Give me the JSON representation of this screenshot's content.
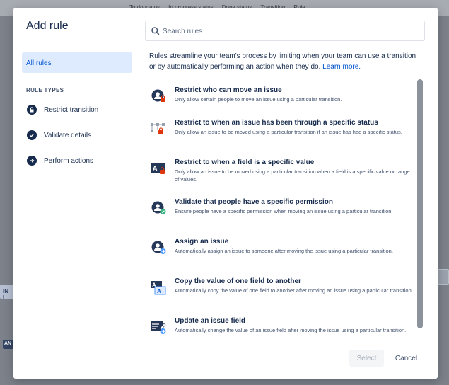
{
  "background": {
    "tabs": [
      "To do status",
      "In progress status",
      "Done status",
      "Transition",
      "Rule"
    ],
    "tag_in": "IN I",
    "tag_an": "AN"
  },
  "modal": {
    "title": "Add rule",
    "search": {
      "placeholder": "Search rules",
      "value": ""
    },
    "intro": "Rules streamline your team's process by limiting when your team can use a transition or by automatically performing an action when they do.",
    "learn_more": "Learn more.",
    "sidebar": {
      "all_rules": "All rules",
      "heading": "RULE TYPES",
      "items": [
        {
          "label": "Restrict transition",
          "icon": "lock-icon"
        },
        {
          "label": "Validate details",
          "icon": "check-circle-icon"
        },
        {
          "label": "Perform actions",
          "icon": "arrow-right-circle-icon"
        }
      ]
    },
    "rules": [
      {
        "title": "Restrict who can move an issue",
        "desc": "Only allow certain people to move an issue using a particular transition.",
        "icon": "user-restrict-icon"
      },
      {
        "title": "Restrict to when an issue has been through a specific status",
        "desc": "Only allow an issue to be moved using a particular transition if an issue has had a specific status.",
        "icon": "workflow-restrict-icon"
      },
      {
        "title": "Restrict to when a field is a specific value",
        "desc": "Only allow an issue to be moved using a particular transition when a field is a specific value or range of values.",
        "icon": "field-restrict-icon"
      },
      {
        "title": "Validate that people have a specific permission",
        "desc": "Ensure people have a specific permission when moving an issue using a particular transition.",
        "icon": "user-check-icon"
      },
      {
        "title": "Assign an issue",
        "desc": "Automatically assign an issue to someone after moving the issue using a particular transition.",
        "icon": "user-assign-icon"
      },
      {
        "title": "Copy the value of one field to another",
        "desc": "Automatically copy the value of one field to another after moving an issue using a particular transition.",
        "icon": "copy-field-icon"
      },
      {
        "title": "Update an issue field",
        "desc": "Automatically change the value of an issue field after moving the issue using a particular transition.",
        "icon": "edit-field-icon"
      }
    ],
    "buttons": {
      "select": "Select",
      "cancel": "Cancel"
    }
  },
  "colors": {
    "accent": "#0052cc",
    "restrict": "#de350b",
    "validate": "#36b37e",
    "action": "#4c9aff",
    "text": "#172b4d"
  }
}
